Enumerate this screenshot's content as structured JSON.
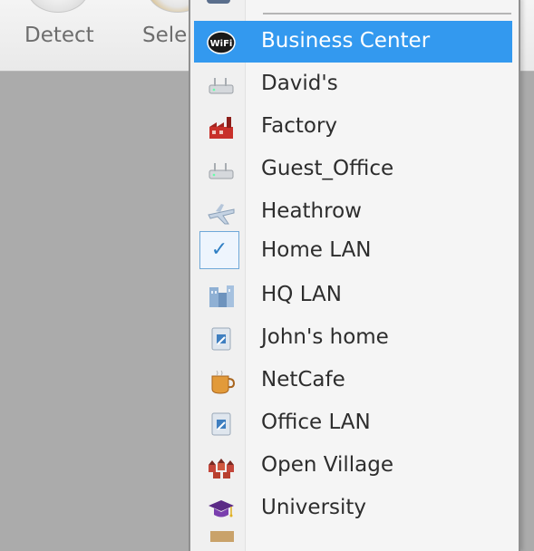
{
  "toolbar": {
    "detect_label": "Detect",
    "select_label": "Sele"
  },
  "menu": {
    "items": [
      {
        "label": "Business Center",
        "icon": "wifi-icon",
        "highlighted": true
      },
      {
        "label": "David's",
        "icon": "router-icon"
      },
      {
        "label": "Factory",
        "icon": "factory-icon"
      },
      {
        "label": "Guest_Office",
        "icon": "router-icon"
      },
      {
        "label": "Heathrow",
        "icon": "airplane-icon"
      },
      {
        "label": "Home LAN",
        "icon": "check-icon",
        "checked": true
      },
      {
        "label": "HQ LAN",
        "icon": "building-icon"
      },
      {
        "label": "John's home",
        "icon": "network-icon"
      },
      {
        "label": "NetCafe",
        "icon": "coffee-icon"
      },
      {
        "label": "Office LAN",
        "icon": "network-icon"
      },
      {
        "label": "Open Village",
        "icon": "village-icon"
      },
      {
        "label": "University",
        "icon": "graduation-cap-icon"
      }
    ]
  },
  "colors": {
    "highlight": "#3399ef",
    "check": "#2f7fc4"
  }
}
